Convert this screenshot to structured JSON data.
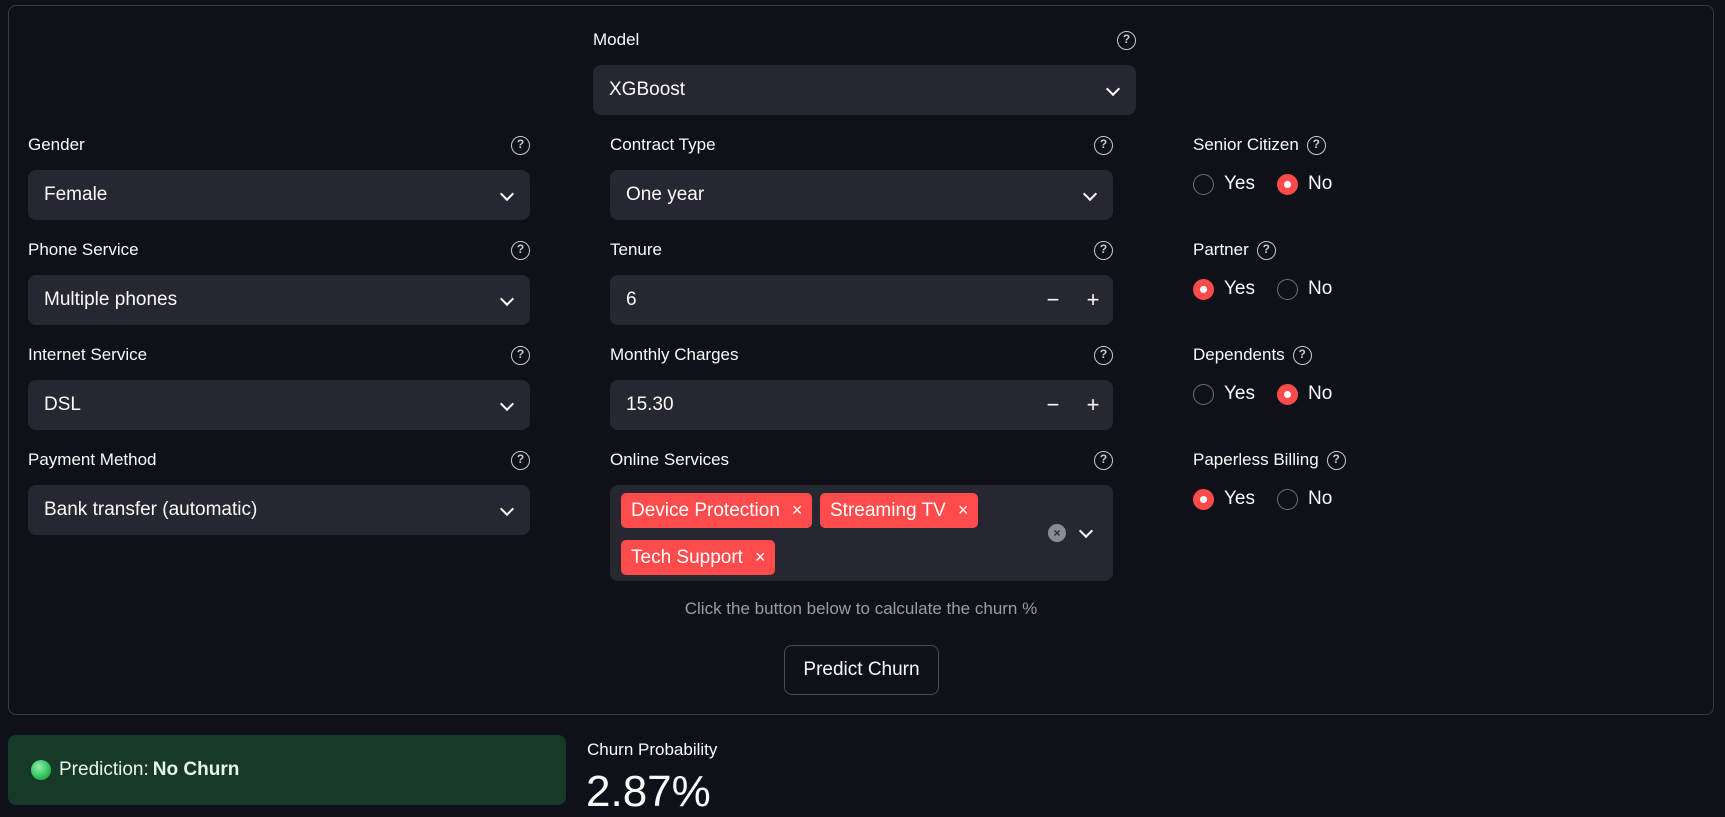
{
  "model": {
    "label": "Model",
    "value": "XGBoost"
  },
  "left_column": [
    {
      "key": "gender",
      "label": "Gender",
      "value": "Female"
    },
    {
      "key": "phone_service",
      "label": "Phone Service",
      "value": "Multiple phones"
    },
    {
      "key": "internet_service",
      "label": "Internet Service",
      "value": "DSL"
    },
    {
      "key": "payment_method",
      "label": "Payment Method",
      "value": "Bank transfer (automatic)"
    }
  ],
  "contract_type": {
    "label": "Contract Type",
    "value": "One year"
  },
  "tenure": {
    "label": "Tenure",
    "value": "6",
    "minus": "−",
    "plus": "+"
  },
  "monthly_charges": {
    "label": "Monthly Charges",
    "value": "15.30",
    "minus": "−",
    "plus": "+"
  },
  "online_services": {
    "label": "Online Services",
    "selected": [
      "Device Protection",
      "Streaming TV",
      "Tech Support"
    ],
    "remove_glyph": "×",
    "clear_glyph": "×"
  },
  "right_column": [
    {
      "key": "senior_citizen",
      "label": "Senior Citizen",
      "options": [
        "Yes",
        "No"
      ],
      "selected": "No"
    },
    {
      "key": "partner",
      "label": "Partner",
      "options": [
        "Yes",
        "No"
      ],
      "selected": "Yes"
    },
    {
      "key": "dependents",
      "label": "Dependents",
      "options": [
        "Yes",
        "No"
      ],
      "selected": "No"
    },
    {
      "key": "paperless_billing",
      "label": "Paperless Billing",
      "options": [
        "Yes",
        "No"
      ],
      "selected": "Yes"
    }
  ],
  "help_glyph": "?",
  "caption": "Click the button below to calculate the churn %",
  "predict_button": "Predict Churn",
  "prediction": {
    "prefix": "Prediction:",
    "value": "No Churn",
    "color": "#173928"
  },
  "metric": {
    "label": "Churn Probability",
    "value": "2.87%"
  },
  "colors": {
    "accent": "#ff4b4b",
    "background": "#0e1117",
    "input": "#262730"
  }
}
